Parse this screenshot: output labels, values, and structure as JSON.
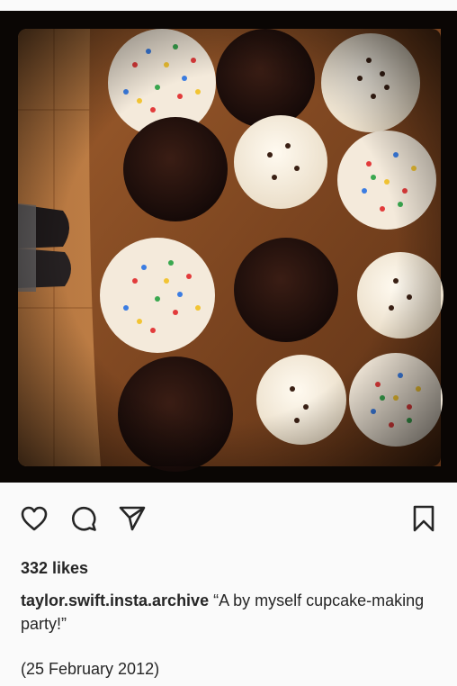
{
  "post": {
    "image_alt": "Tray of chocolate, vanilla and sprinkle cupcakes",
    "actions": {
      "like_icon": "heart-icon",
      "comment_icon": "comment-bubble-icon",
      "share_icon": "paper-plane-icon",
      "save_icon": "bookmark-icon"
    },
    "likes": "332 likes",
    "username": "taylor.swift.insta.archive",
    "caption_text": "“A by myself cupcake-making party!”",
    "date_text": "(25 February 2012)"
  }
}
